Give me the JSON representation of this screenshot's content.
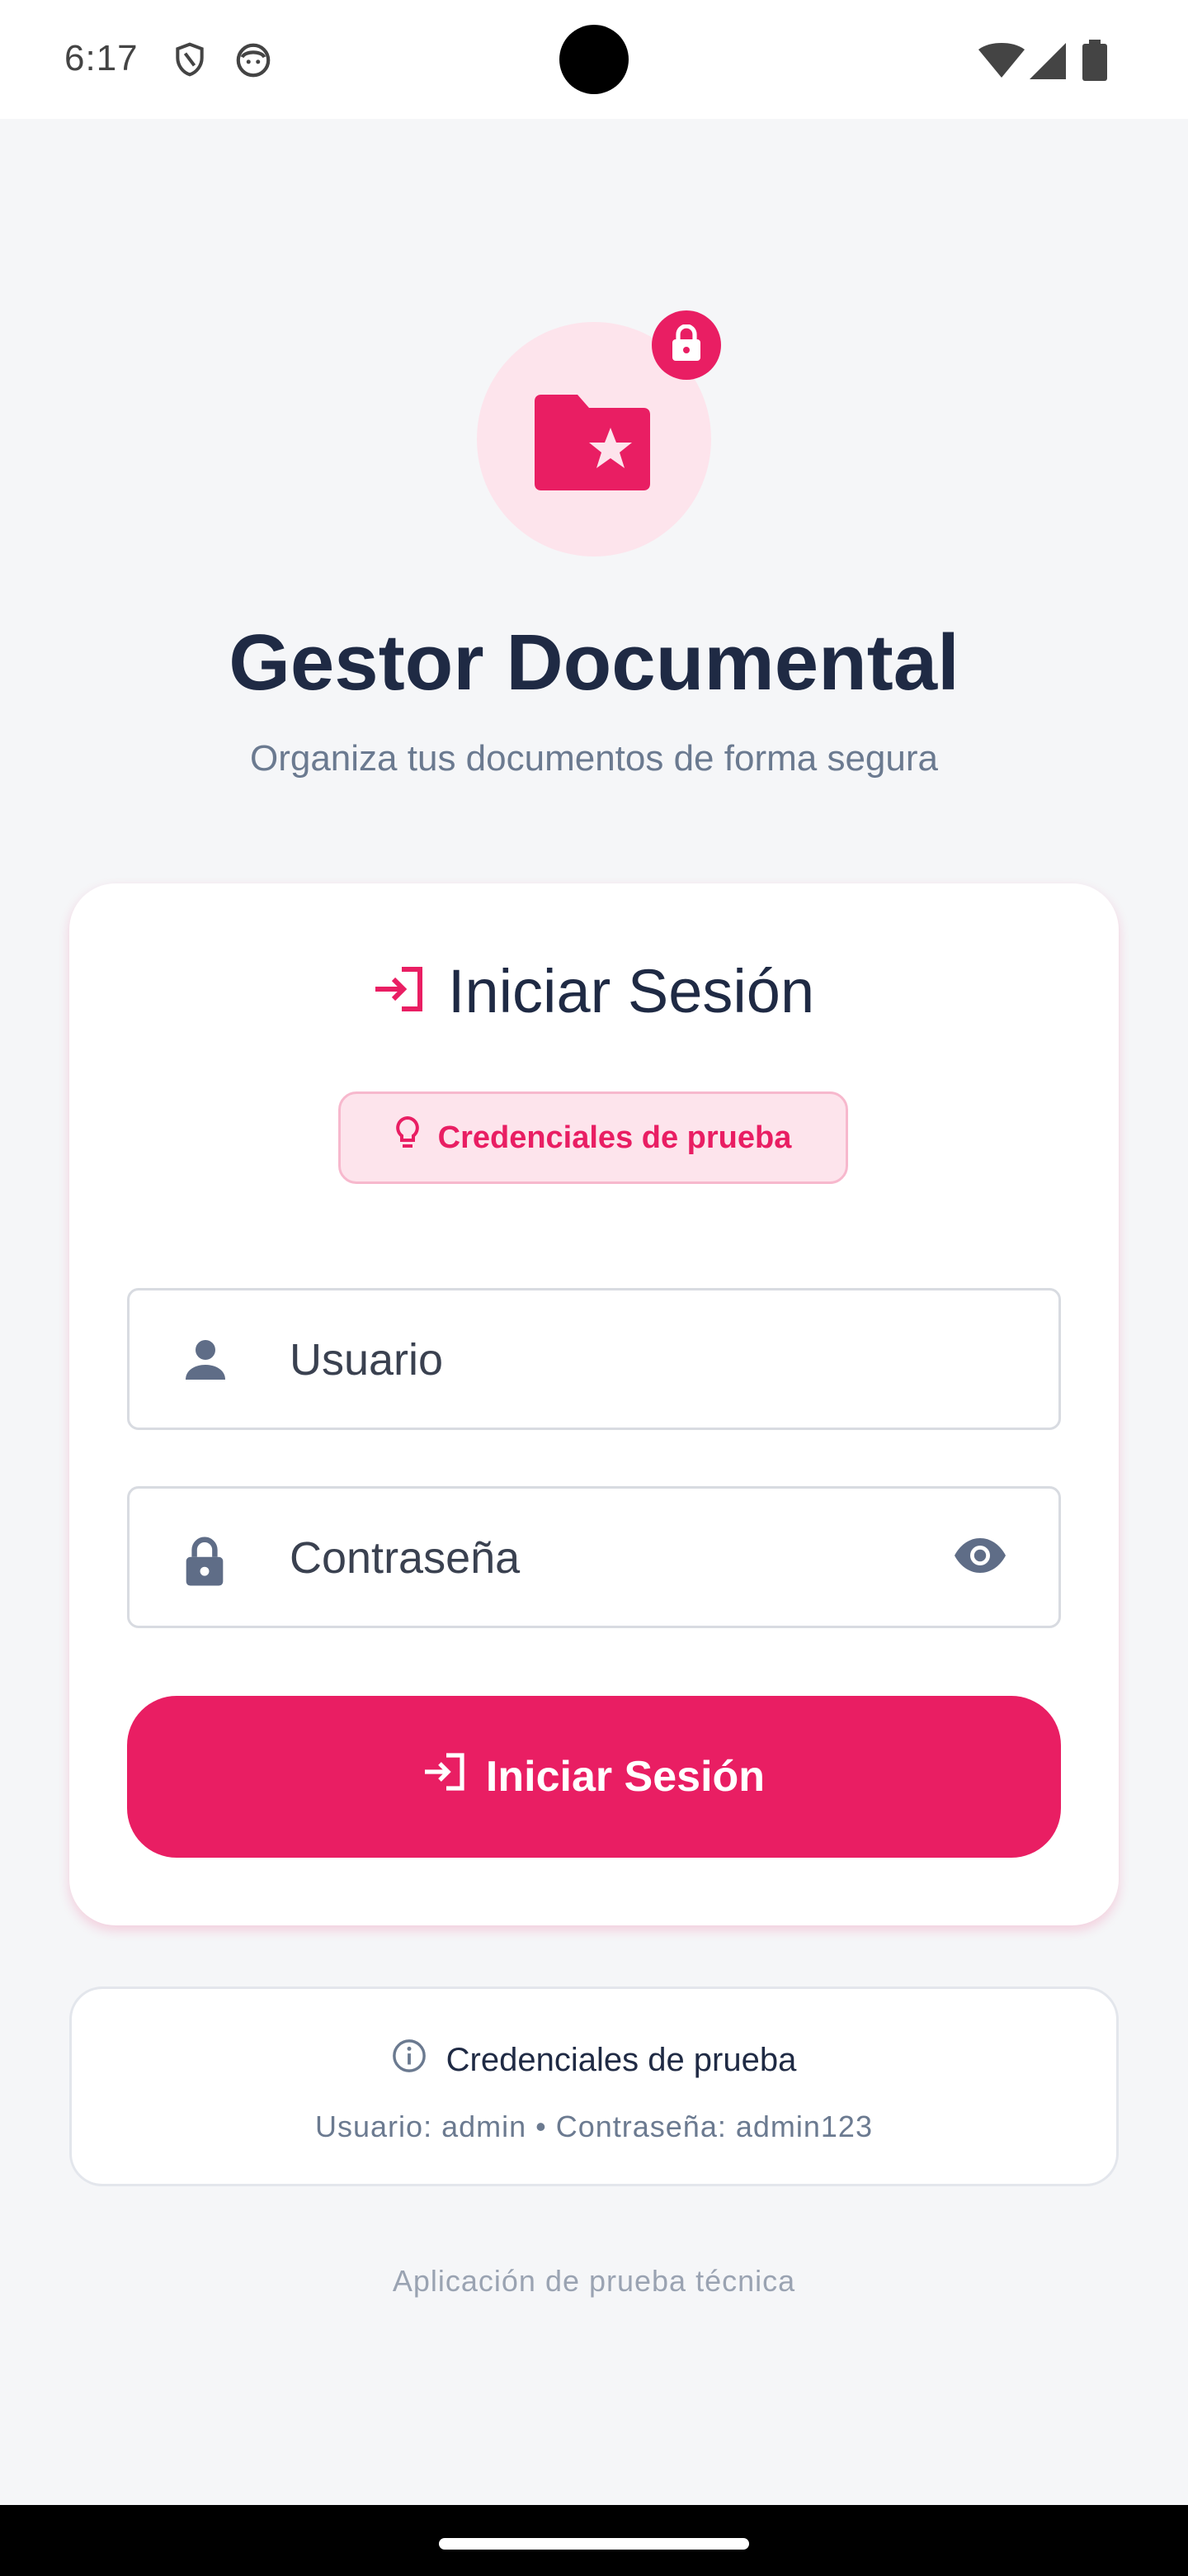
{
  "status_bar": {
    "time": "6:17",
    "icons": [
      "shield-icon",
      "face-icon",
      "wifi-icon",
      "signal-icon",
      "battery-icon"
    ]
  },
  "header": {
    "title": "Gestor Documental",
    "subtitle": "Organiza tus documentos de forma segura"
  },
  "login_card": {
    "heading": "Iniciar Sesión",
    "credentials_chip": "Credenciales de prueba",
    "username_placeholder": "Usuario",
    "password_placeholder": "Contraseña",
    "submit_label": "Iniciar Sesión"
  },
  "info_box": {
    "title": "Credenciales de prueba",
    "credentials": "Usuario: admin • Contraseña: admin123"
  },
  "footer": {
    "text": "Aplicación de prueba técnica"
  },
  "colors": {
    "accent": "#e91e63",
    "accent_light": "#fde4ec",
    "text_primary": "#1f2a44",
    "text_secondary": "#6b7a90",
    "background": "#f5f6f8"
  }
}
